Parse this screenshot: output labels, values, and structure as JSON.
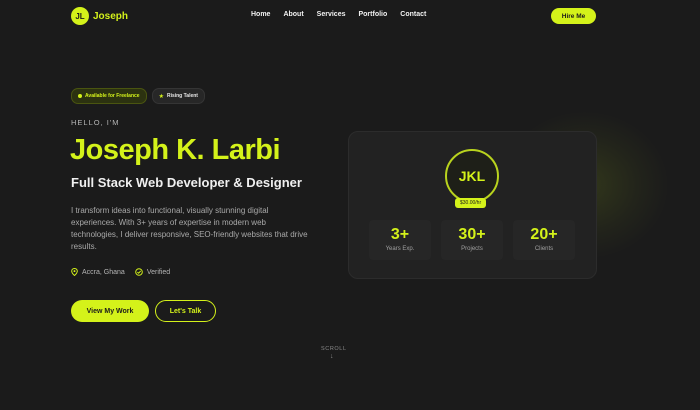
{
  "nav": {
    "logo_initials": "JL",
    "logo_name": "Joseph",
    "items": [
      "Home",
      "About",
      "Services",
      "Portfolio",
      "Contact"
    ],
    "hire_label": "Hire Me"
  },
  "badges": {
    "freelance": "Available for Freelance",
    "talent": "Rising Talent"
  },
  "hero": {
    "greeting": "HELLO, I'M",
    "name": "Joseph K. Larbi",
    "role": "Full Stack Web Developer & Designer",
    "description": "I transform ideas into functional, visually stunning digital experiences. With 3+ years of expertise in modern web technologies, I deliver responsive, SEO-friendly websites that drive results.",
    "location": "Accra, Ghana",
    "verified": "Verified",
    "primary_cta": "View My Work",
    "secondary_cta": "Let's Talk"
  },
  "card": {
    "initials": "JKL",
    "rate": "$30.00/hr",
    "stats": [
      {
        "value": "3+",
        "label": "Years Exp."
      },
      {
        "value": "30+",
        "label": "Projects"
      },
      {
        "value": "20+",
        "label": "Clients"
      }
    ]
  },
  "scroll": {
    "label": "SCROLL",
    "icon": "arrow-down-icon"
  },
  "colors": {
    "accent": "#d4f21a",
    "background": "#1b1b1b"
  }
}
